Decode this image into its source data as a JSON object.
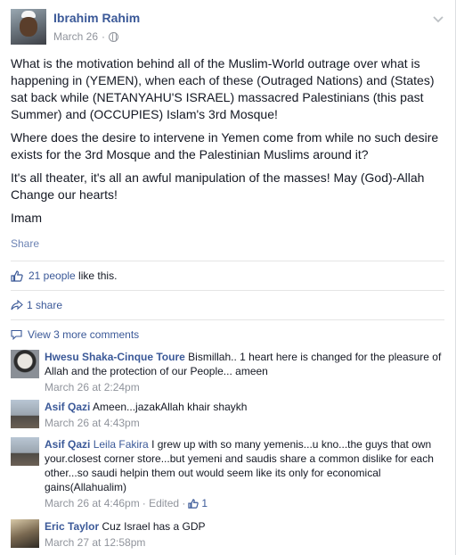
{
  "post": {
    "author": "Ibrahim Rahim",
    "date": "March 26",
    "meta_separator": "·",
    "paragraphs": [
      "What is the motivation behind all of the Muslim-World outrage over what is happening in (YEMEN), when each of these (Outraged Nations) and (States) sat back while (NETANYAHU'S ISRAEL) massacred Palestinians (this past Summer) and (OCCUPIES) Islam's 3rd Mosque!",
      "Where does the desire to intervene in Yemen come from while no such desire exists for the 3rd Mosque and the Palestinian Muslims around it?",
      "It's all theater, it's all an awful manipulation of the masses! May (God)-Allah Change our hearts!",
      "Imam"
    ],
    "share_label": "Share",
    "likes_link": "21 people",
    "likes_suffix": " like this.",
    "shares_label": "1 share",
    "view_more_label": "View 3 more comments"
  },
  "comments": [
    {
      "author": "Hwesu Shaka-Cinque Toure",
      "text": " Bismillah.. 1 heart here is changed for the pleasure of Allah and the protection of our People... ameen",
      "time": "March 26 at 2:24pm"
    },
    {
      "author": "Asif Qazi",
      "text": " Ameen...jazakAllah khair shaykh",
      "time": "March 26 at 4:43pm"
    },
    {
      "author": "Asif Qazi",
      "tag": "Leila Fakira",
      "text": " I grew up with so many yemenis...u kno...the guys that own your.closest corner store...but yemeni and saudis share a common dislike for each other...so saudi helpin them out would seem like its only for economical gains(Allahualim)",
      "time": "March 26 at 4:46pm",
      "edited": "· Edited ·",
      "likes": "1"
    },
    {
      "author": "Eric Taylor",
      "text": " Cuz Israel has a GDP",
      "time": "March 27 at 12:58pm"
    }
  ],
  "colors": {
    "link": "#3b5998",
    "meta": "#90949c",
    "divider": "#e5e5e5"
  }
}
